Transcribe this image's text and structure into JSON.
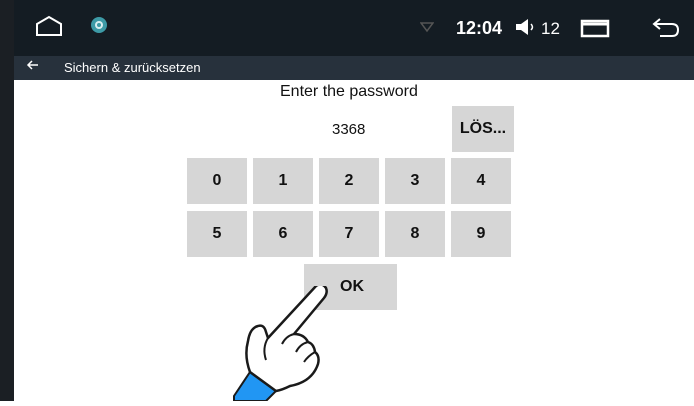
{
  "status_bar": {
    "home_icon": "home-icon",
    "settings_icon": "gear-icon",
    "wifi_icon": "wifi-icon",
    "time": "12:04",
    "volume_icon": "volume-icon",
    "volume_level": "12",
    "recents_icon": "recents-icon",
    "back_icon": "back-icon"
  },
  "action_bar": {
    "back_icon": "arrow-left-icon",
    "title": "Sichern & zurücksetzen"
  },
  "keypad": {
    "prompt": "Enter the password",
    "entered_value": "3368",
    "clear_label": "LÖS...",
    "row1": [
      "0",
      "1",
      "2",
      "3",
      "4"
    ],
    "row2": [
      "5",
      "6",
      "7",
      "8",
      "9"
    ],
    "ok_label": "OK"
  },
  "colors": {
    "status_bg": "#141c23",
    "action_bg": "#27313c",
    "key_bg": "#d6d6d6",
    "hand_cuff": "#2196f3"
  }
}
